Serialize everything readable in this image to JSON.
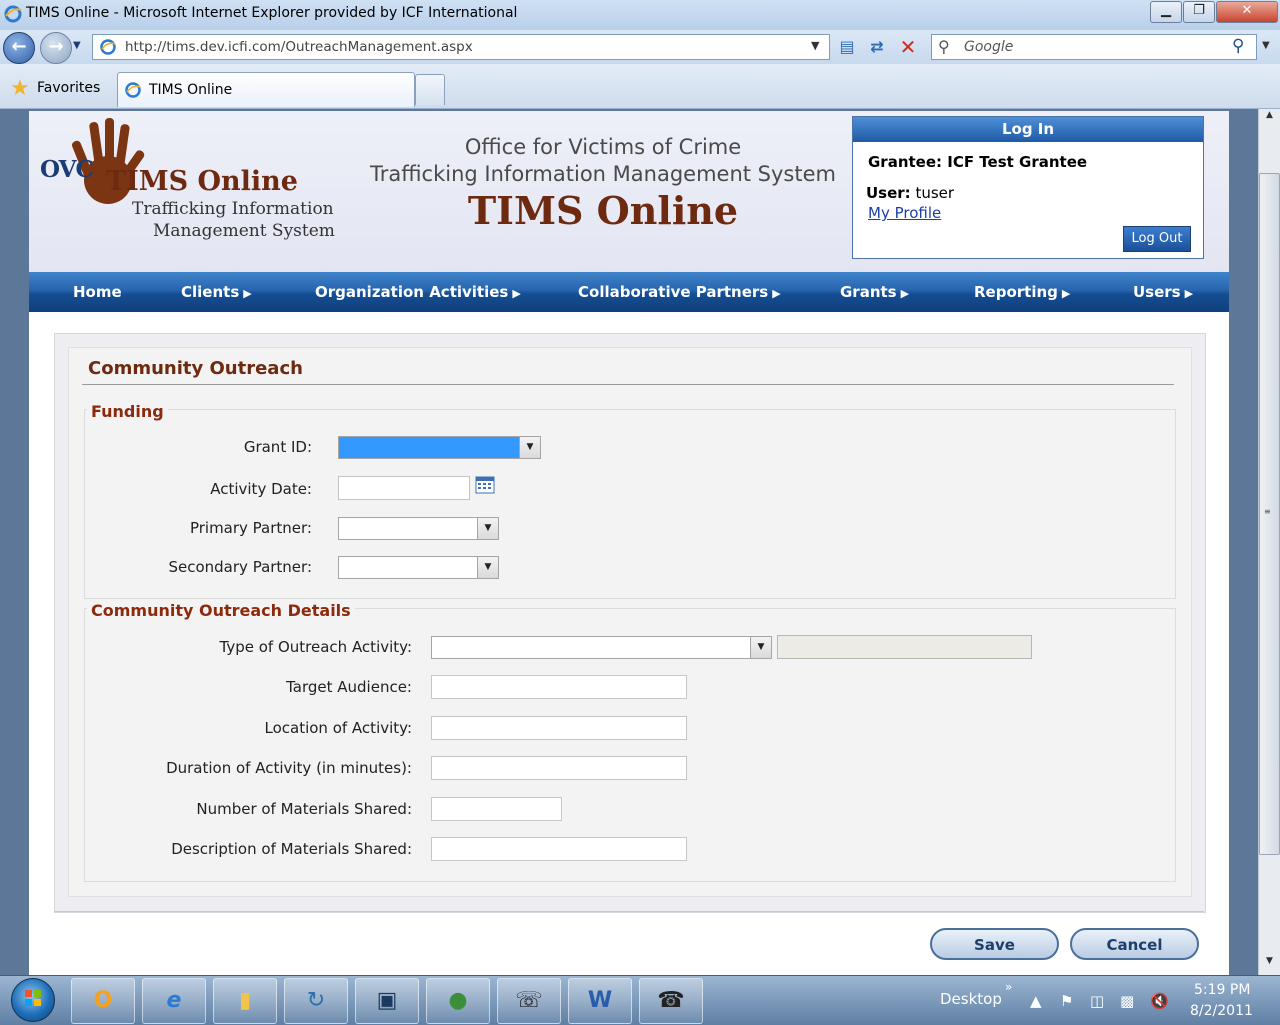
{
  "window": {
    "title": "TIMS Online - Microsoft Internet Explorer provided by ICF International",
    "minimize": "▁",
    "maximize": "❐",
    "close": "✕"
  },
  "browser": {
    "back_icon": "back-arrow-icon",
    "forward_icon": "forward-arrow-icon",
    "url": "http://tims.dev.icfi.com/OutreachManagement.aspx",
    "search_placeholder": "Google",
    "favorites_label": "Favorites",
    "tab_label": "TIMS Online"
  },
  "header": {
    "logo_ovc": "OVC",
    "logo_title": "TIMS Online",
    "logo_sub1": "Trafficking Information",
    "logo_sub2": "Management System",
    "line1": "Office for Victims of Crime",
    "line2": "Trafficking Information Management System",
    "line3": "TIMS Online"
  },
  "login": {
    "heading": "Log In",
    "grantee": "Grantee: ICF Test Grantee",
    "user_label": "User:",
    "user_value": "tuser",
    "profile_link": "My Profile",
    "logout": "Log Out"
  },
  "menu": {
    "items": [
      {
        "label": "Home",
        "has_submenu": false
      },
      {
        "label": "Clients",
        "has_submenu": true
      },
      {
        "label": "Organization Activities",
        "has_submenu": true
      },
      {
        "label": "Collaborative Partners",
        "has_submenu": true
      },
      {
        "label": "Grants",
        "has_submenu": true
      },
      {
        "label": "Reporting",
        "has_submenu": true
      },
      {
        "label": "Users",
        "has_submenu": true
      }
    ]
  },
  "form": {
    "title": "Community Outreach",
    "funding": {
      "legend": "Funding",
      "grant_id_label": "Grant ID:",
      "grant_id_value": "",
      "activity_date_label": "Activity Date:",
      "activity_date_value": "",
      "primary_partner_label": "Primary Partner:",
      "primary_partner_value": "",
      "secondary_partner_label": "Secondary Partner:",
      "secondary_partner_value": ""
    },
    "details": {
      "legend": "Community Outreach Details",
      "type_label": "Type of Outreach Activity:",
      "type_value": "",
      "type_other_value": "",
      "target_audience_label": "Target Audience:",
      "target_audience_value": "",
      "location_label": "Location of Activity:",
      "location_value": "",
      "duration_label": "Duration of Activity (in minutes):",
      "duration_value": "",
      "materials_count_label": "Number of Materials Shared:",
      "materials_count_value": "",
      "materials_desc_label": "Description of Materials Shared:",
      "materials_desc_value": ""
    },
    "save": "Save",
    "cancel": "Cancel"
  },
  "taskbar": {
    "desktop_label": "Desktop",
    "time": "5:19 PM",
    "date": "8/2/2011",
    "apps": [
      "outlook-icon",
      "internet-explorer-icon",
      "folder-icon",
      "remote-desktop-icon",
      "network-manager-icon",
      "users-lock-icon",
      "phone-icon",
      "word-icon",
      "fax-icon"
    ]
  },
  "colors": {
    "menu_blue": "#1f5aa8",
    "brand_brown": "#6d2a10",
    "legend_brown": "#8c2a0e",
    "selection_blue": "#3399ff"
  }
}
